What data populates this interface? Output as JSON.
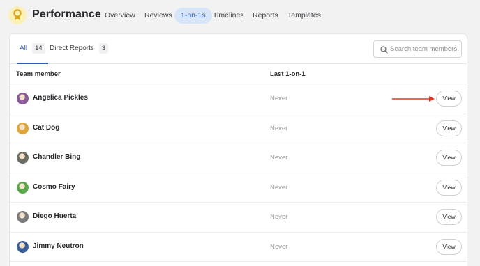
{
  "header": {
    "app_title": "Performance",
    "nav": [
      {
        "label": "Overview",
        "active": false
      },
      {
        "label": "Reviews",
        "active": false
      },
      {
        "label": "1-on-1s",
        "active": true
      },
      {
        "label": "Timelines",
        "active": false
      },
      {
        "label": "Reports",
        "active": false
      },
      {
        "label": "Templates",
        "active": false
      }
    ]
  },
  "tabs": [
    {
      "label": "All",
      "count": "14",
      "active": true
    },
    {
      "label": "Direct Reports",
      "count": "3",
      "active": false
    }
  ],
  "search": {
    "placeholder": "Search team members.",
    "value": ""
  },
  "table": {
    "columns": [
      "Team member",
      "Last 1-on-1"
    ],
    "view_label": "View",
    "rows": [
      {
        "name": "Angelica Pickles",
        "last": "Never",
        "avatar_color": "#8a5a9c"
      },
      {
        "name": "Cat Dog",
        "last": "Never",
        "avatar_color": "#e0a63a"
      },
      {
        "name": "Chandler Bing",
        "last": "Never",
        "avatar_color": "#6b6f63"
      },
      {
        "name": "Cosmo Fairy",
        "last": "Never",
        "avatar_color": "#5aa84a"
      },
      {
        "name": "Diego Huerta",
        "last": "Never",
        "avatar_color": "#7a7a7a"
      },
      {
        "name": "Jimmy Neutron",
        "last": "Never",
        "avatar_color": "#3a5f9a"
      }
    ]
  },
  "colors": {
    "accent": "#2f5fb5",
    "annotation_arrow": "#e0371e",
    "logo_bg": "#fbf0b8",
    "logo_fg": "#d9a919"
  },
  "annotation": {
    "arrow_row": 0
  }
}
